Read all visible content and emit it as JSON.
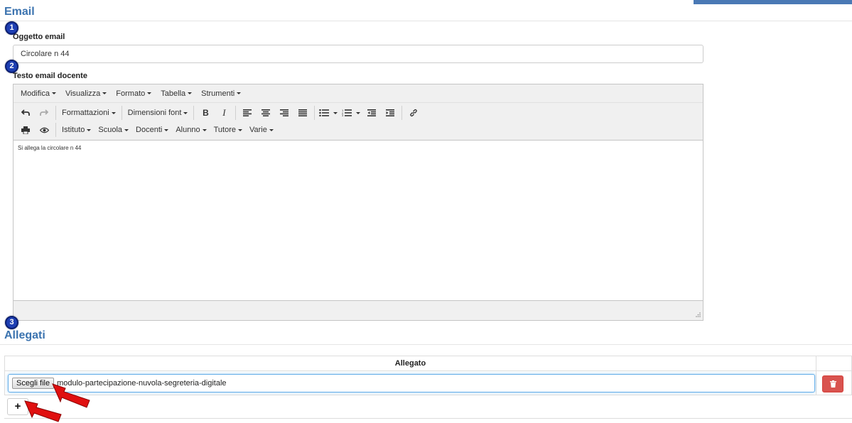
{
  "email_section": {
    "title": "Email",
    "step1": "1",
    "step2": "2",
    "subject_label": "Oggetto email",
    "subject_value": "Circolare n 44",
    "body_label": "Testo email docente"
  },
  "editor": {
    "menu": [
      "Modifica",
      "Visualizza",
      "Formato",
      "Tabella",
      "Strumenti"
    ],
    "formats_label": "Formattazioni",
    "font_size_label": "Dimensioni font",
    "bold": "B",
    "italic": "I",
    "placeholders": [
      "Istituto",
      "Scuola",
      "Docenti",
      "Alunno",
      "Tutore",
      "Varie"
    ],
    "content": "Si allega la circolare n 44"
  },
  "attachments_section": {
    "title": "Allegati",
    "step3": "3",
    "column_header": "Allegato",
    "choose_file_label": "Scegli file",
    "file_name": "modulo-partecipazione-nuvola-segreteria-digitale",
    "add_label": "+"
  },
  "colors": {
    "title": "#3b73af",
    "badge": "#1e3fb3",
    "delete_button": "#d9534f",
    "arrow": "#e01010"
  }
}
